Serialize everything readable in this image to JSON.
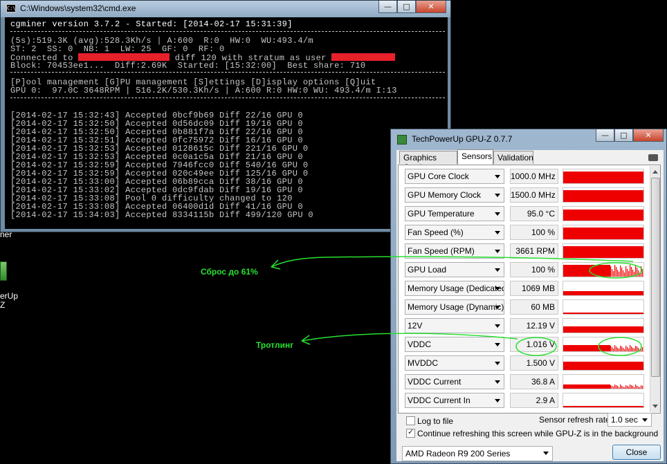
{
  "desktop": {
    "icon_text_1": "ner",
    "icon_text_2": "erUp",
    "icon_text_3": "Z"
  },
  "cmd": {
    "title": "C:\\Windows\\system32\\cmd.exe",
    "icon_text": "C:\\",
    "lines": {
      "version": "cgminer version 3.7.2 - Started: [2014-02-17 15:31:39]",
      "speed": "(5s):519.3K (avg):528.3Kh/s | A:600  R:0  HW:0  WU:493.4/m",
      "stats": "ST: 2  SS: 0  NB: 1  LW: 25  GF: 0  RF: 0",
      "connected_prefix": "Connected to ",
      "connected_mid": " diff 120 with stratum as user ",
      "block": "Block: 70453ee1...  Diff:2.69K  Started: [15:32:00]  Best share: 710",
      "menu": "[P]ool management [G]PU management [S]ettings [D]isplay options [Q]uit",
      "gpu": "GPU 0:  97.0C 3648RPM | 516.2K/530.3Kh/s | A:600 R:0 HW:0 WU: 493.4/m I:13"
    },
    "log": [
      "[2014-02-17 15:32:43] Accepted 0bcf9b69 Diff 22/16 GPU 0",
      "[2014-02-17 15:32:50] Accepted 0d56dc09 Diff 19/16 GPU 0",
      "[2014-02-17 15:32:50] Accepted 0b881f7a Diff 22/16 GPU 0",
      "[2014-02-17 15:32:51] Accepted 0fc75972 Diff 16/16 GPU 0",
      "[2014-02-17 15:32:53] Accepted 0128615c Diff 221/16 GPU 0",
      "[2014-02-17 15:32:53] Accepted 0c0a1c5a Diff 21/16 GPU 0",
      "[2014-02-17 15:32:59] Accepted 7946fcc0 Diff 540/16 GPU 0",
      "[2014-02-17 15:32:59] Accepted 020c49ee Diff 125/16 GPU 0",
      "[2014-02-17 15:33:00] Accepted 06b89cca Diff 38/16 GPU 0",
      "[2014-02-17 15:33:02] Accepted 0dc9fdab Diff 19/16 GPU 0",
      "[2014-02-17 15:33:08] Pool 0 difficulty changed to 120",
      "[2014-02-17 15:33:08] Accepted 06400d1d Diff 41/16 GPU 0",
      "[2014-02-17 15:34:03] Accepted 8334115b Diff 499/120 GPU 0"
    ]
  },
  "window_buttons": {
    "minimize": "—",
    "maximize": "□",
    "close": "✕"
  },
  "gpuz": {
    "title": "TechPowerUp GPU-Z 0.7.7",
    "tabs": [
      "Graphics Card",
      "Sensors",
      "Validation"
    ],
    "active_tab": "Sensors",
    "sensors": [
      {
        "name": "GPU Core Clock",
        "value": "1000.0 MHz",
        "fill": 0.85,
        "spiky": false
      },
      {
        "name": "GPU Memory Clock",
        "value": "1500.0 MHz",
        "fill": 0.85,
        "spiky": false
      },
      {
        "name": "GPU Temperature",
        "value": "95.0 °C",
        "fill": 0.8,
        "spiky": false
      },
      {
        "name": "Fan Speed (%)",
        "value": "100 %",
        "fill": 0.85,
        "spiky": false
      },
      {
        "name": "Fan Speed (RPM)",
        "value": "3661 RPM",
        "fill": 0.85,
        "spiky": false
      },
      {
        "name": "GPU Load",
        "value": "100 %",
        "fill": 0.85,
        "spiky": true
      },
      {
        "name": "Memory Usage (Dedicated)",
        "value": "1069 MB",
        "fill": 0.3,
        "spiky": false
      },
      {
        "name": "Memory Usage (Dynamic)",
        "value": "60 MB",
        "fill": 0.12,
        "spiky": false
      },
      {
        "name": "12V",
        "value": "12.19 V",
        "fill": 0.45,
        "spiky": false
      },
      {
        "name": "VDDC",
        "value": "1.016 V",
        "fill": 0.45,
        "spiky": true
      },
      {
        "name": "MVDDC",
        "value": "1.500 V",
        "fill": 0.6,
        "spiky": false
      },
      {
        "name": "VDDC Current",
        "value": "36.8 A",
        "fill": 0.3,
        "spiky": true
      },
      {
        "name": "VDDC Current In",
        "value": "2.9 A",
        "fill": 0.1,
        "spiky": false
      }
    ],
    "log_to_file": "Log to file",
    "log_to_file_checked": false,
    "refresh_label": "Sensor refresh rate:",
    "refresh_value": "1.0 sec",
    "continue_label": "Continue refreshing this screen while GPU-Z is in the background",
    "continue_checked": true,
    "card": "AMD Radeon R9 200 Series",
    "close": "Close",
    "graph_color": "#ee0000"
  },
  "annotations": {
    "reset_label": "Сброс до 61%",
    "throttling_label": "Тротлинг",
    "color": "#29e030"
  }
}
